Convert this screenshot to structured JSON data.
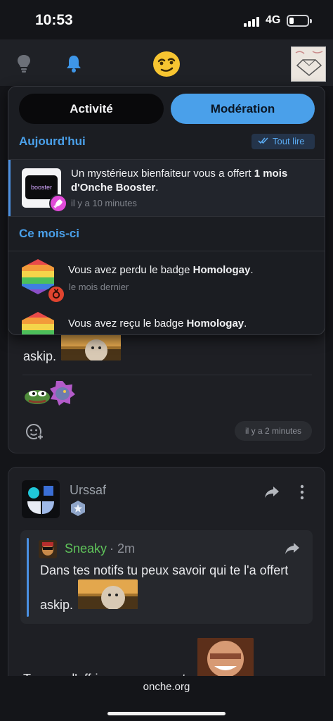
{
  "status_bar": {
    "time": "10:53",
    "network": "4G",
    "battery_level": 0.2
  },
  "top_nav": {
    "icons": [
      "lightbulb-icon",
      "bell-icon",
      "smiley-logo-icon",
      "user-avatar"
    ]
  },
  "notifications": {
    "tabs": [
      {
        "label": "Activité",
        "active": false
      },
      {
        "label": "Modération",
        "active": true
      }
    ],
    "today_header": "Aujourd'hui",
    "read_all_label": "Tout lire",
    "today_items": [
      {
        "text_prefix": "Un mystérieux bienfaiteur vous a offert ",
        "text_bold": "1 mois d'Onche Booster",
        "text_suffix": ".",
        "time": "il y a 10 minutes",
        "thumb_label": "booster",
        "badge_icon": "rocket-icon"
      }
    ],
    "month_header": "Ce mois-ci",
    "month_items": [
      {
        "text_prefix": "Vous avez perdu le badge ",
        "text_bold": "Homologay",
        "text_suffix": ".",
        "time": "le mois dernier",
        "badge_icon": "medal-icon"
      },
      {
        "text_prefix": "Vous avez reçu le badge ",
        "text_bold": "Homologay",
        "text_suffix": ".",
        "time": ""
      }
    ]
  },
  "feed": {
    "post1": {
      "text": "askip.",
      "time": "il y a 2 minutes"
    },
    "post2": {
      "author": "Urssaf",
      "quote": {
        "author": "Sneaky",
        "time": "2m",
        "text": "Dans tes notifs tu peux savoir qui te l'a offert",
        "text2": "askip."
      },
      "text": "Tu peux l'offrir anonymement"
    }
  },
  "url_bar": {
    "url": "onche.org"
  },
  "colors": {
    "accent": "#4aa0ea",
    "sneaky": "#5fc35a",
    "background": "#141519",
    "card": "#1e1f24"
  }
}
